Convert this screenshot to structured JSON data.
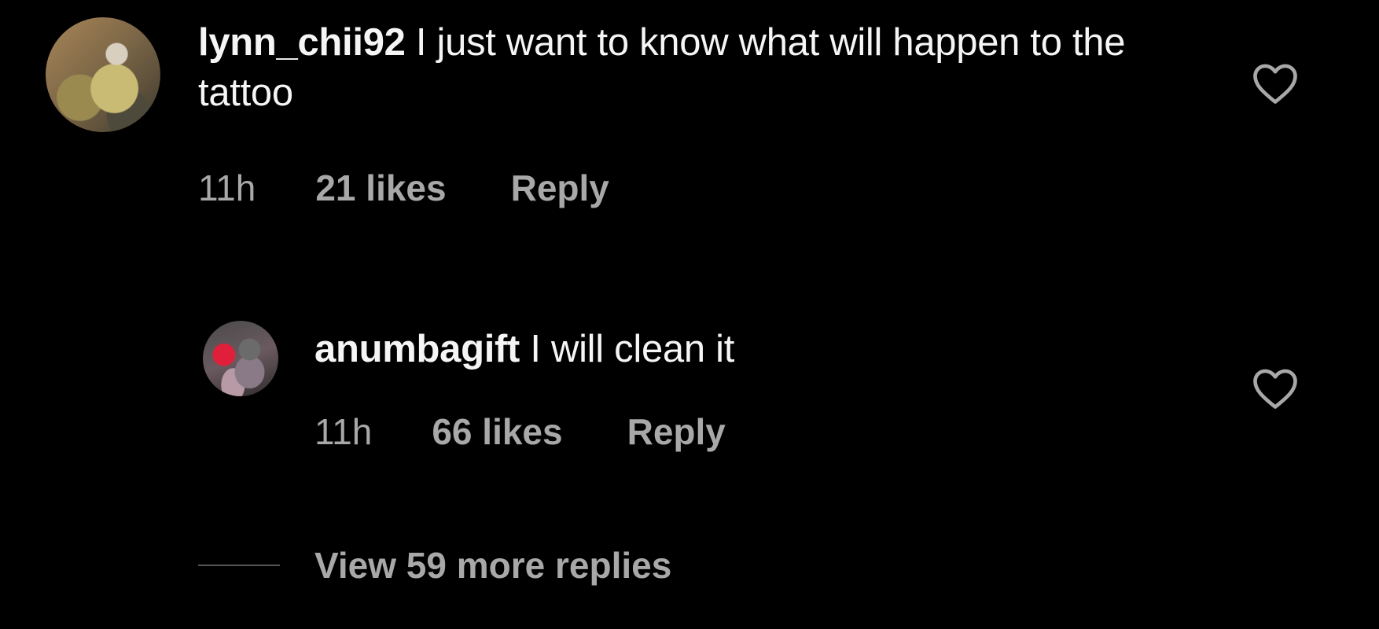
{
  "comments": [
    {
      "username": "lynn_chii92",
      "text": "I just want to know what will happen to the tattoo",
      "time": "11h",
      "likes": "21 likes",
      "reply_label": "Reply",
      "avatar_icon": "user-avatar-photo",
      "like_icon": "heart-outline-icon"
    },
    {
      "username": "anumbagift",
      "text": "I will clean it",
      "time": "11h",
      "likes": "66 likes",
      "reply_label": "Reply",
      "avatar_icon": "user-avatar-photo",
      "like_icon": "heart-outline-icon"
    }
  ],
  "view_more_replies": "View 59 more replies",
  "colors": {
    "background": "#000000",
    "primary_text": "#f5f5f5",
    "secondary_text": "#a8a8a8",
    "divider": "#555555"
  }
}
